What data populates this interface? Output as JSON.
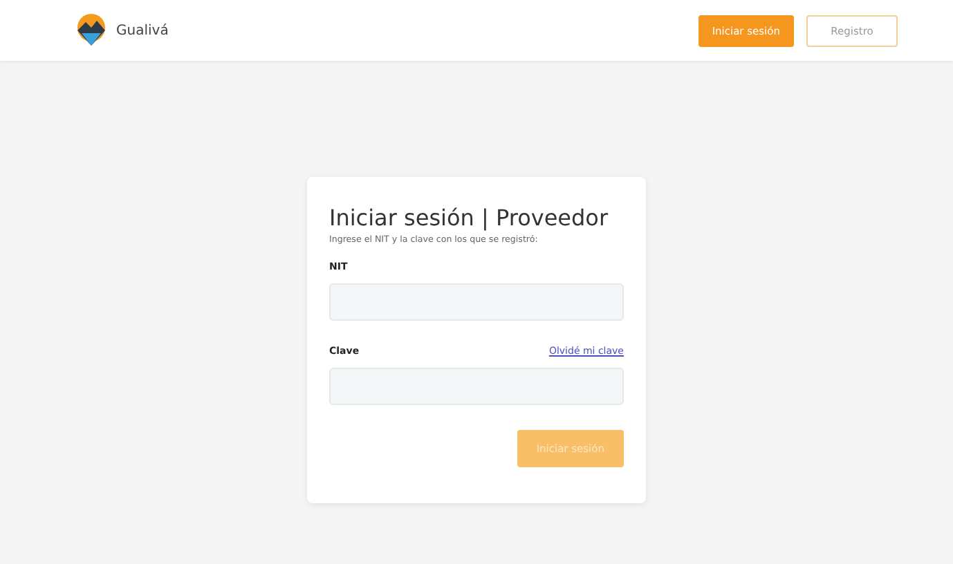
{
  "header": {
    "brand": "Gualivá",
    "buttons": [
      {
        "label": "Iniciar sesión",
        "kind": "primary"
      },
      {
        "label": "Registro",
        "kind": "outline"
      }
    ]
  },
  "login": {
    "title": "Iniciar sesión | Proveedor",
    "subtitle": "Ingrese el NIT y la clave con los que se registró:",
    "fields": [
      {
        "label": "NIT"
      },
      {
        "label": "Clave",
        "link": "Olvidé mi clave"
      }
    ],
    "submit": {
      "label": "Iniciar sesión",
      "disabled": true
    }
  }
}
